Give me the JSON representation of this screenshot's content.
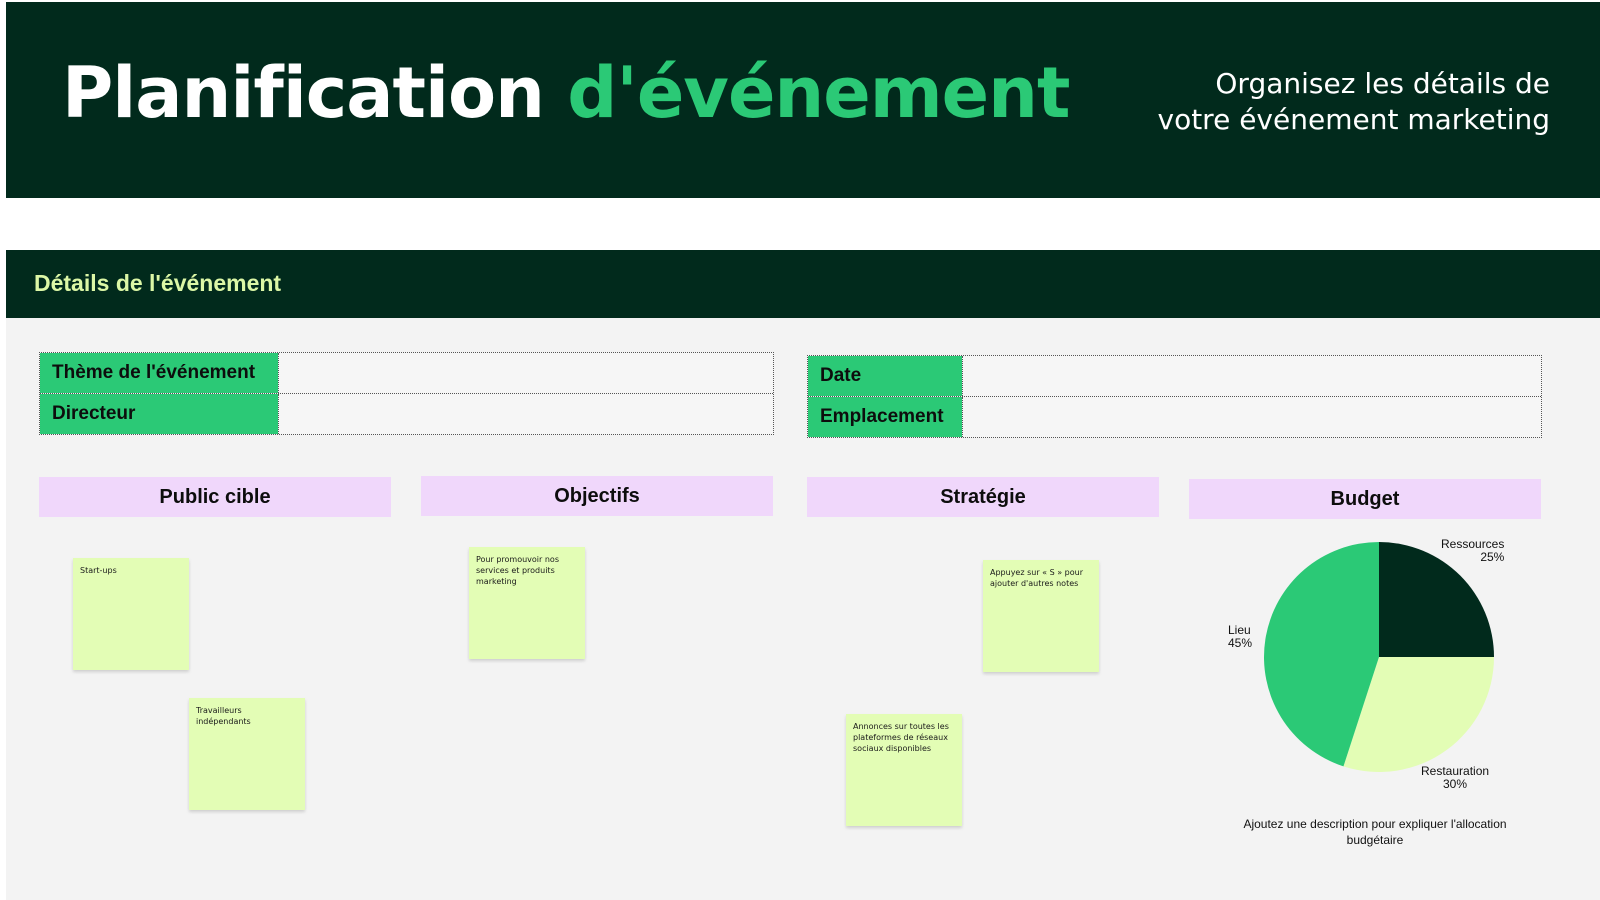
{
  "header": {
    "title_main": "Planification",
    "title_accent": "d'événement",
    "subtitle_line1": "Organisez les détails de",
    "subtitle_line2": "votre événement marketing"
  },
  "section": {
    "title": "Détails de l'événement"
  },
  "info_left": [
    {
      "label": "Thème de l'événement",
      "value": ""
    },
    {
      "label": "Directeur",
      "value": ""
    }
  ],
  "info_right": [
    {
      "label": "Date",
      "value": ""
    },
    {
      "label": "Emplacement",
      "value": ""
    }
  ],
  "columns": {
    "audience": "Public cible",
    "objectives": "Objectifs",
    "strategy": "Stratégie",
    "budget": "Budget"
  },
  "notes": {
    "audience_1": "Start-ups",
    "audience_2": "Travailleurs indépendants",
    "objective_1": "Pour promouvoir nos services et produits marketing",
    "strategy_1": "Appuyez sur « S » pour ajouter d'autres notes",
    "strategy_2": "Annonces sur toutes les plateformes de réseaux sociaux disponibles"
  },
  "budget": {
    "description": "Ajoutez une description pour expliquer l'allocation budgétaire"
  },
  "colors": {
    "dark_green": "#012a1c",
    "accent_green": "#2bc976",
    "light_lime": "#e3fdb5",
    "lavender": "#f0d7fb",
    "section_text": "#dcf7a6"
  },
  "chart_data": {
    "type": "pie",
    "slices": [
      {
        "label": "Ressources",
        "value": 25,
        "display": "25%",
        "color": "#012a1c"
      },
      {
        "label": "Restauration",
        "value": 30,
        "display": "30%",
        "color": "#e3fdb5"
      },
      {
        "label": "Lieu",
        "value": 45,
        "display": "45%",
        "color": "#2bc976"
      }
    ]
  }
}
